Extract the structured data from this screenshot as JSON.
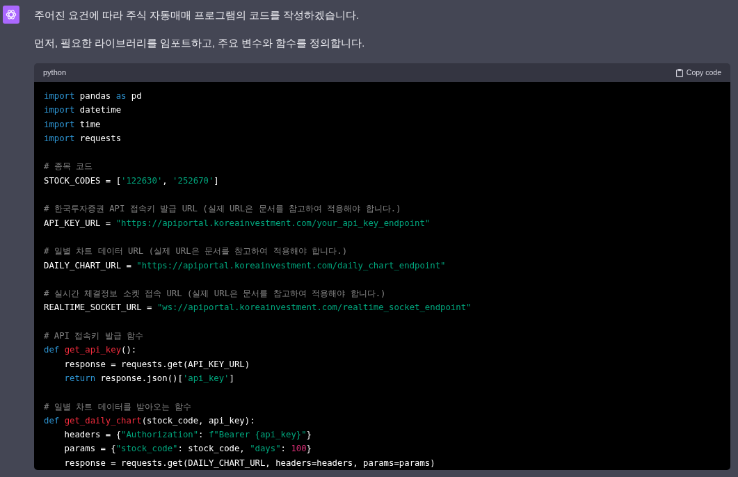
{
  "message": {
    "paragraphs": [
      "주어진 요건에 따라 주식 자동매매 프로그램의 코드를 작성하겠습니다.",
      "먼저, 필요한 라이브러리를 임포트하고, 주요 변수와 함수를 정의합니다."
    ],
    "code_block": {
      "language": "python",
      "copy_button": "Copy code",
      "lines": [
        {
          "kind": "code",
          "tokens": [
            {
              "kind": "keyword",
              "text": "import"
            },
            {
              "kind": "plain",
              "text": " pandas "
            },
            {
              "kind": "keyword",
              "text": "as"
            },
            {
              "kind": "plain",
              "text": " pd"
            }
          ]
        },
        {
          "kind": "code",
          "tokens": [
            {
              "kind": "keyword",
              "text": "import"
            },
            {
              "kind": "plain",
              "text": " datetime"
            }
          ]
        },
        {
          "kind": "code",
          "tokens": [
            {
              "kind": "keyword",
              "text": "import"
            },
            {
              "kind": "plain",
              "text": " time"
            }
          ]
        },
        {
          "kind": "code",
          "tokens": [
            {
              "kind": "keyword",
              "text": "import"
            },
            {
              "kind": "plain",
              "text": " requests"
            }
          ]
        },
        {
          "kind": "blank"
        },
        {
          "kind": "code",
          "tokens": [
            {
              "kind": "comment",
              "text": "# 종목 코드"
            }
          ]
        },
        {
          "kind": "code",
          "tokens": [
            {
              "kind": "plain",
              "text": "STOCK_CODES = ["
            },
            {
              "kind": "string",
              "text": "'122630'"
            },
            {
              "kind": "plain",
              "text": ", "
            },
            {
              "kind": "string",
              "text": "'252670'"
            },
            {
              "kind": "plain",
              "text": "]"
            }
          ]
        },
        {
          "kind": "blank"
        },
        {
          "kind": "code",
          "tokens": [
            {
              "kind": "comment",
              "text": "# 한국투자증권 API 접속키 발급 URL (실제 URL은 문서를 참고하여 적용해야 합니다.)"
            }
          ]
        },
        {
          "kind": "code",
          "tokens": [
            {
              "kind": "plain",
              "text": "API_KEY_URL = "
            },
            {
              "kind": "string",
              "text": "\"https://apiportal.koreainvestment.com/your_api_key_endpoint\""
            }
          ]
        },
        {
          "kind": "blank"
        },
        {
          "kind": "code",
          "tokens": [
            {
              "kind": "comment",
              "text": "# 일별 차트 데이터 URL (실제 URL은 문서를 참고하여 적용해야 합니다.)"
            }
          ]
        },
        {
          "kind": "code",
          "tokens": [
            {
              "kind": "plain",
              "text": "DAILY_CHART_URL = "
            },
            {
              "kind": "string",
              "text": "\"https://apiportal.koreainvestment.com/daily_chart_endpoint\""
            }
          ]
        },
        {
          "kind": "blank"
        },
        {
          "kind": "code",
          "tokens": [
            {
              "kind": "comment",
              "text": "# 실시간 체결정보 소켓 접속 URL (실제 URL은 문서를 참고하여 적용해야 합니다.)"
            }
          ]
        },
        {
          "kind": "code",
          "tokens": [
            {
              "kind": "plain",
              "text": "REALTIME_SOCKET_URL = "
            },
            {
              "kind": "string",
              "text": "\"ws://apiportal.koreainvestment.com/realtime_socket_endpoint\""
            }
          ]
        },
        {
          "kind": "blank"
        },
        {
          "kind": "code",
          "tokens": [
            {
              "kind": "comment",
              "text": "# API 접속키 발급 함수"
            }
          ]
        },
        {
          "kind": "code",
          "tokens": [
            {
              "kind": "keyword",
              "text": "def "
            },
            {
              "kind": "function",
              "text": "get_api_key"
            },
            {
              "kind": "plain",
              "text": "():"
            }
          ]
        },
        {
          "kind": "code",
          "indented": true,
          "tokens": [
            {
              "kind": "plain",
              "text": "response = requests.get(API_KEY_URL)"
            }
          ]
        },
        {
          "kind": "code",
          "indented": true,
          "tokens": [
            {
              "kind": "keyword",
              "text": "return"
            },
            {
              "kind": "plain",
              "text": " response.json()["
            },
            {
              "kind": "string",
              "text": "'api_key'"
            },
            {
              "kind": "plain",
              "text": "]"
            }
          ]
        },
        {
          "kind": "blank"
        },
        {
          "kind": "code",
          "tokens": [
            {
              "kind": "comment",
              "text": "# 일별 차트 데이터를 받아오는 함수"
            }
          ]
        },
        {
          "kind": "code",
          "tokens": [
            {
              "kind": "keyword",
              "text": "def "
            },
            {
              "kind": "function",
              "text": "get_daily_chart"
            },
            {
              "kind": "plain",
              "text": "(stock_code, api_key):"
            }
          ]
        },
        {
          "kind": "code",
          "indented": true,
          "tokens": [
            {
              "kind": "plain",
              "text": "headers = {"
            },
            {
              "kind": "string",
              "text": "\"Authorization\""
            },
            {
              "kind": "plain",
              "text": ": "
            },
            {
              "kind": "string",
              "text": "f\"Bearer {api_key}\""
            },
            {
              "kind": "plain",
              "text": "}"
            }
          ]
        },
        {
          "kind": "code",
          "indented": true,
          "tokens": [
            {
              "kind": "plain",
              "text": "params = {"
            },
            {
              "kind": "string",
              "text": "\"stock_code\""
            },
            {
              "kind": "plain",
              "text": ": stock_code, "
            },
            {
              "kind": "string",
              "text": "\"days\""
            },
            {
              "kind": "plain",
              "text": ": "
            },
            {
              "kind": "number",
              "text": "100"
            },
            {
              "kind": "plain",
              "text": "}"
            }
          ]
        },
        {
          "kind": "code",
          "indented": true,
          "tokens": [
            {
              "kind": "plain",
              "text": "response = requests.get(DAILY_CHART_URL, headers=headers, params=params)"
            }
          ]
        }
      ]
    }
  }
}
